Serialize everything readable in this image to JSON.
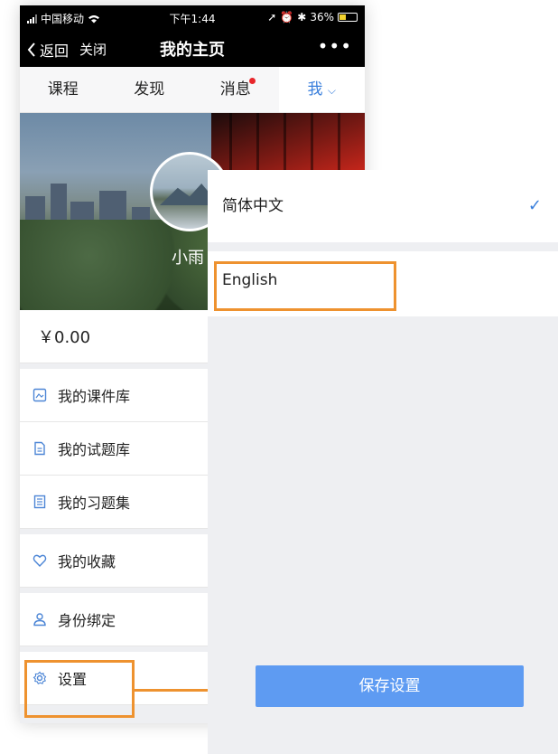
{
  "statusbar": {
    "carrier": "中国移动",
    "time": "下午1:44",
    "battery": "36%",
    "battery_level": 0.36
  },
  "navbar": {
    "back_label": "返回",
    "close_label": "关闭",
    "title": "我的主页",
    "more_label": "•••"
  },
  "tabs": [
    {
      "label": "课程"
    },
    {
      "label": "发现"
    },
    {
      "label": "消息",
      "has_dot": true
    },
    {
      "label": "我",
      "active": true
    }
  ],
  "profile": {
    "username": "小雨"
  },
  "balance": "￥0.00",
  "menu": [
    {
      "label": "我的课件库",
      "icon": "courseware-icon"
    },
    {
      "label": "我的试题库",
      "icon": "document-icon"
    },
    {
      "label": "我的习题集",
      "icon": "list-document-icon"
    },
    {
      "label": "我的收藏",
      "icon": "heart-icon"
    },
    {
      "label": "身份绑定",
      "icon": "user-icon"
    },
    {
      "label": "设置",
      "icon": "gear-icon"
    }
  ],
  "language_panel": {
    "options": [
      {
        "label": "简体中文",
        "selected": true
      },
      {
        "label": "English",
        "selected": false
      }
    ],
    "save_label": "保存设置"
  },
  "colors": {
    "accent": "#3a7fdc",
    "highlight": "#ee922f",
    "save_button": "#5e9bf2",
    "badge": "#e8262b"
  }
}
